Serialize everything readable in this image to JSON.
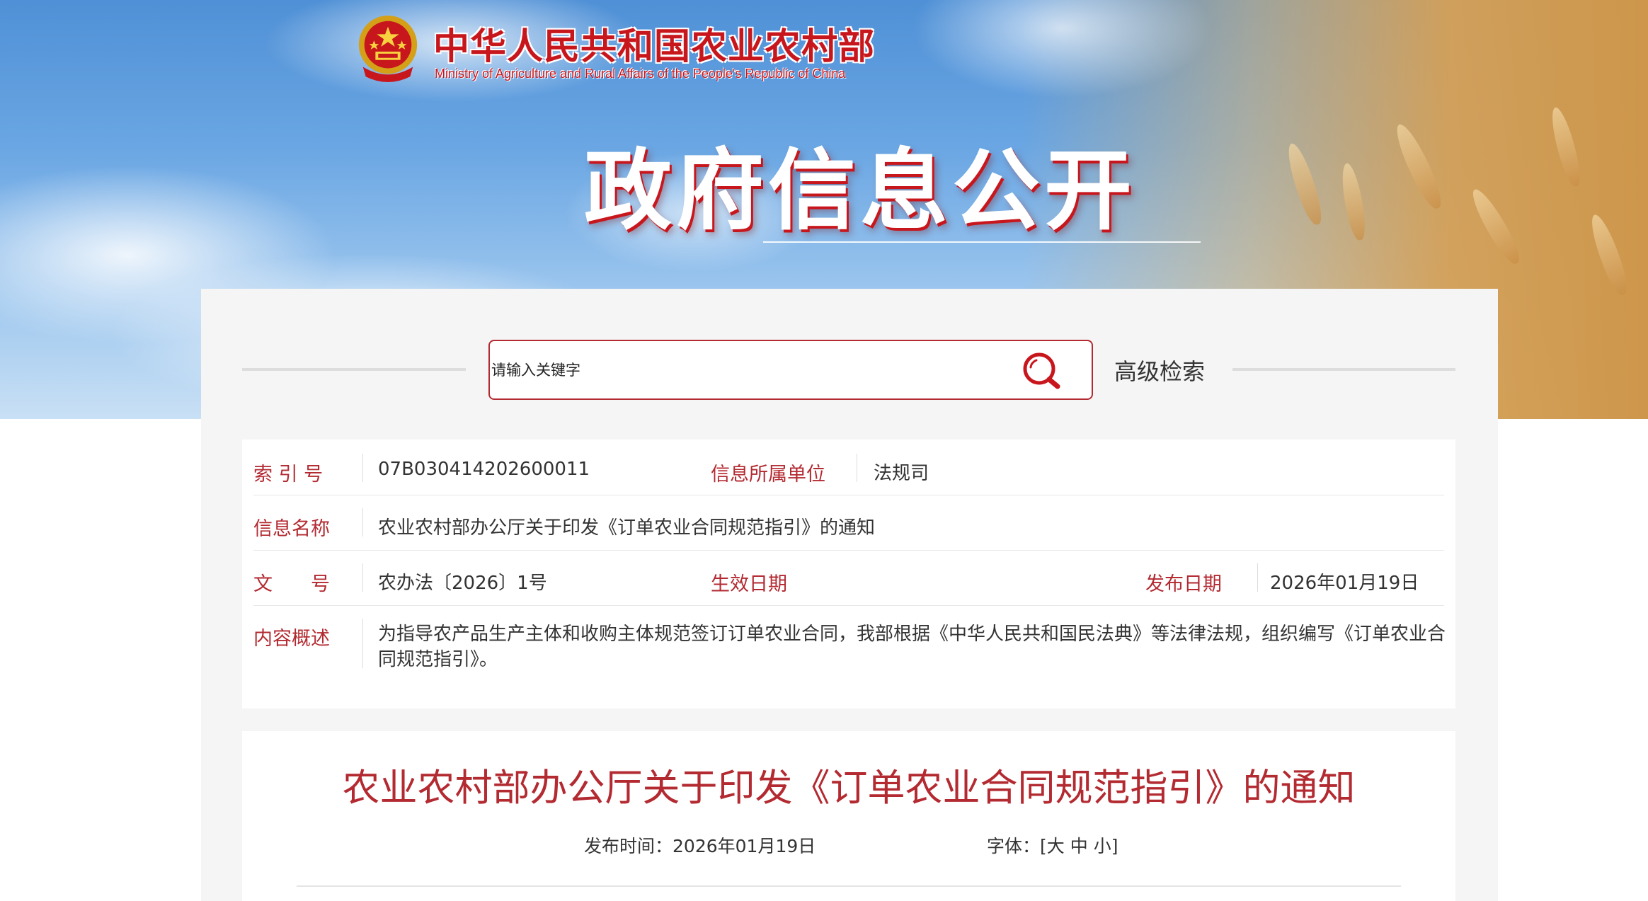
{
  "header": {
    "ministry_cn": "中华人民共和国农业农村部",
    "ministry_en": "Ministry of Agriculture and Rural Affairs of the People's Republic of China",
    "banner_title": "政府信息公开"
  },
  "search": {
    "placeholder": "请输入关键字",
    "advanced_label": "高级检索"
  },
  "info": {
    "index_label": "索 引 号",
    "index_value": "07B030414202600011",
    "unit_label": "信息所属单位",
    "unit_value": "法规司",
    "name_label": "信息名称",
    "name_value": "农业农村部办公厅关于印发《订单农业合同规范指引》的通知",
    "doc_no_label": "文　　号",
    "doc_no_value": "农办法〔2026〕1号",
    "effective_label": "生效日期",
    "effective_value": "",
    "publish_label": "发布日期",
    "publish_value": "2026年01月19日",
    "summary_label": "内容概述",
    "summary_value": "为指导农产品生产主体和收购主体规范签订订单农业合同，我部根据《中华人民共和国民法典》等法律法规，组织编写《订单农业合同规范指引》。"
  },
  "article": {
    "title": "农业农村部办公厅关于印发《订单农业合同规范指引》的通知",
    "publish_time_label": "发布时间：",
    "publish_time_value": "2026年01月19日",
    "font_label": "字体：",
    "font_open": "[",
    "font_large": "大",
    "font_medium": "中",
    "font_small": "小",
    "font_close": "]"
  },
  "colors": {
    "accent_red": "#b32a31",
    "brand_red": "#c8161d",
    "panel_bg": "#f5f5f5"
  }
}
